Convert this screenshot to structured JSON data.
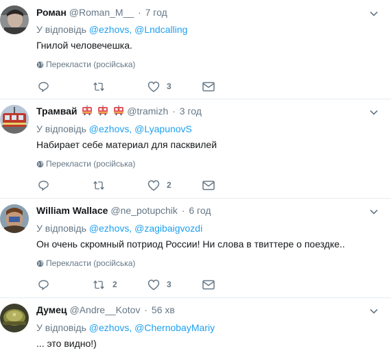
{
  "colors": {
    "link": "#1da1f2",
    "secondary": "#657786",
    "text": "#14171a",
    "divider": "#e6ecf0"
  },
  "reply_prefix": "У відповідь",
  "translate_label": "Перекласти (російська)",
  "tweets": [
    {
      "name": "Роман",
      "handle": "@Roman_M__",
      "time": "7 год",
      "reply_to": [
        "@ezhovs",
        "@Lndcalling"
      ],
      "text": "Гнилой человечешка.",
      "show_translate": true,
      "replies": "",
      "retweets": "",
      "likes": "3",
      "avatar_icon": "person-photo-icon"
    },
    {
      "name": "Трамвай",
      "handle": "@tramizh",
      "time": "3 год",
      "reply_to": [
        "@ezhovs",
        "@LyapunovS"
      ],
      "text": "Набирает себе материал для пасквилей",
      "show_translate": true,
      "replies": "",
      "retweets": "",
      "likes": "2",
      "avatar_icon": "tram-photo-icon",
      "name_emoji": [
        "tram-emoji-icon",
        "tram-emoji-icon",
        "tram-emoji-icon"
      ]
    },
    {
      "name": "William Wallace",
      "handle": "@ne_potupchik",
      "time": "6 год",
      "reply_to": [
        "@ezhovs",
        "@zagibaigvozdi"
      ],
      "text": "Он очень скромный потриод России! Ни слова в твиттере о поездке..",
      "show_translate": true,
      "replies": "",
      "retweets": "2",
      "likes": "3",
      "avatar_icon": "warrior-photo-icon"
    },
    {
      "name": "Думец",
      "handle": "@Andre__Kotov",
      "time": "56 хв",
      "reply_to": [
        "@ezhovs",
        "@ChernobayMariy"
      ],
      "text": "... это видно!)",
      "show_translate": false,
      "avatar_icon": "helmet-photo-icon"
    }
  ]
}
